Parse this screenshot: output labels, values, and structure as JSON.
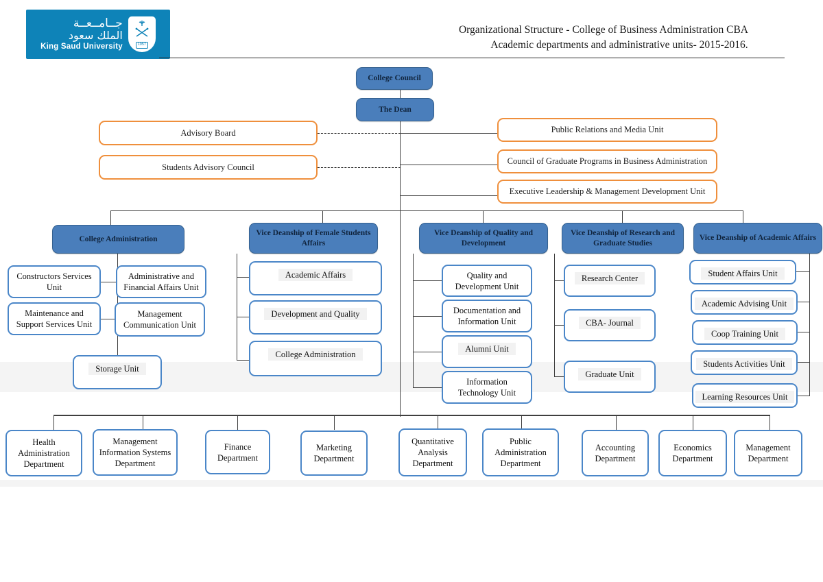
{
  "header": {
    "logo": {
      "arabic_line1": "جــامــعــة",
      "arabic_line2": "الملك سعود",
      "english": "King Saud University",
      "crest_year": "1957",
      "brand_color": "#0e83b8"
    },
    "title_line1": "Organizational Structure - College of Business Administration CBA",
    "title_line2": "Academic departments and administrative units- 2015-2016."
  },
  "top": {
    "college_council": "College Council",
    "dean": "The Dean"
  },
  "advisory_left": [
    {
      "label": "Advisory Board"
    },
    {
      "label": "Students Advisory Council"
    }
  ],
  "units_right": [
    {
      "label": "Public Relations and Media Unit"
    },
    {
      "label": "Council of Graduate Programs in Business Administration"
    },
    {
      "label": "Executive Leadership & Management Development Unit"
    }
  ],
  "columns": [
    {
      "head": "College Administration",
      "children": [
        {
          "label": "Constructors Services Unit"
        },
        {
          "label": "Administrative and Financial Affairs Unit"
        },
        {
          "label": "Maintenance and Support Services Unit"
        },
        {
          "label": "Management Communication Unit"
        },
        {
          "label": "Storage Unit"
        }
      ]
    },
    {
      "head": "Vice Deanship of Female Students Affairs",
      "children": [
        {
          "label": "Academic Affairs"
        },
        {
          "label": "Development and Quality"
        },
        {
          "label": "College Administration"
        }
      ]
    },
    {
      "head": "Vice Deanship of Quality and Development",
      "children": [
        {
          "label": "Quality and Development Unit"
        },
        {
          "label": "Documentation and Information Unit"
        },
        {
          "label": "Alumni Unit"
        },
        {
          "label": "Information Technology Unit"
        }
      ]
    },
    {
      "head": "Vice Deanship of Research and Graduate Studies",
      "children": [
        {
          "label": "Research Center"
        },
        {
          "label": "CBA- Journal"
        },
        {
          "label": "Graduate Unit"
        }
      ]
    },
    {
      "head": "Vice Deanship of Academic Affairs",
      "children": [
        {
          "label": "Student Affairs Unit"
        },
        {
          "label": "Academic Advising Unit"
        },
        {
          "label": "Coop Training Unit"
        },
        {
          "label": "Students Activities Unit"
        },
        {
          "label": "Learning Resources Unit"
        }
      ]
    }
  ],
  "departments": [
    {
      "label": "Health Administration Department"
    },
    {
      "label": "Management Information Systems Department"
    },
    {
      "label": "Finance Department"
    },
    {
      "label": "Marketing Department"
    },
    {
      "label": "Quantitative Analysis Department"
    },
    {
      "label": "Public Administration Department"
    },
    {
      "label": "Accounting Department"
    },
    {
      "label": "Economics Department"
    },
    {
      "label": "Management Department"
    }
  ],
  "colors": {
    "blue_box": "#4a7ebb",
    "blue_border": "#35618f",
    "orange_border": "#ef8f3c",
    "white_border": "#4a86c8",
    "logo_blue": "#0e83b8",
    "line": "#3f3f3f"
  }
}
